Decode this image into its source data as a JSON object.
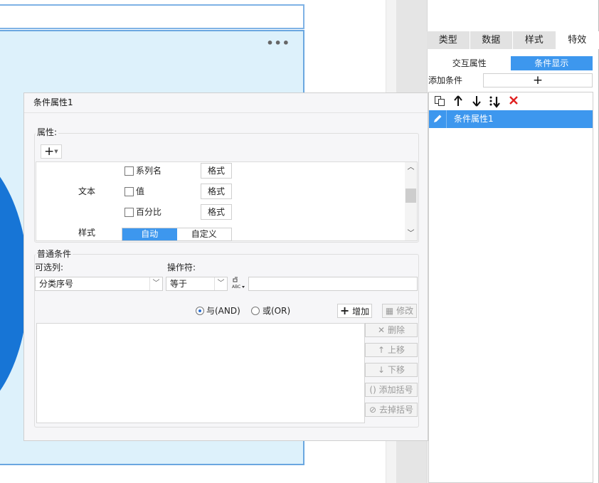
{
  "canvas": {
    "more_icon": "more-horizontal-icon",
    "chart_color": "#1775d6",
    "selection_color": "#6aa7e0"
  },
  "right_panel": {
    "tabs": [
      "类型",
      "数据",
      "样式",
      "特效"
    ],
    "active_tab": "特效",
    "sub_tabs": [
      "交互属性",
      "条件显示"
    ],
    "active_sub_tab": "条件显示",
    "add_condition_label": "添加条件",
    "add_condition_symbol": "+",
    "toolbar_icons": [
      "copy-icon",
      "arrow-up-icon",
      "arrow-down-icon",
      "move-bottom-icon",
      "delete-icon"
    ],
    "conditions": [
      {
        "label": "条件属性1",
        "selected": true
      }
    ],
    "accent": "#3d97ee",
    "delete_color": "#e02020"
  },
  "dialog": {
    "title": "条件属性1",
    "properties": {
      "group_label": "属性:",
      "add_symbol": "+",
      "text_label": "文本",
      "options": [
        {
          "label": "系列名",
          "checked": false,
          "button": "格式"
        },
        {
          "label": "值",
          "checked": false,
          "button": "格式"
        },
        {
          "label": "百分比",
          "checked": false,
          "button": "格式"
        }
      ],
      "style_label": "样式",
      "style_options": [
        "自动",
        "自定义"
      ],
      "style_selected": "自动"
    },
    "normal_conditions": {
      "group_label": "普通条件",
      "column_label": "可选列:",
      "column_value": "分类序号",
      "operator_label": "操作符:",
      "operator_value": "等于",
      "value": "",
      "logic": [
        {
          "label": "与(AND)",
          "selected": true
        },
        {
          "label": "或(OR)",
          "selected": false
        }
      ],
      "buttons": {
        "add": "增加",
        "modify": "修改",
        "delete": "删除",
        "move_up": "上移",
        "move_down": "下移",
        "add_bracket": "添加括号",
        "remove_bracket": "去掉括号"
      }
    }
  }
}
